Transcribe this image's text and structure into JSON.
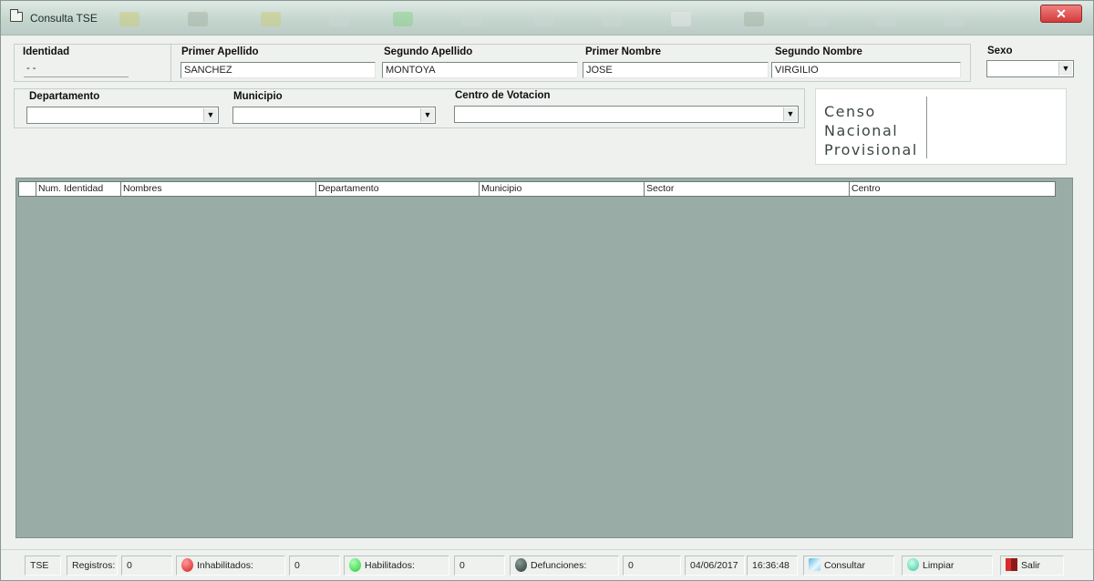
{
  "window": {
    "title": "Consulta TSE",
    "close_glyph": "✕"
  },
  "search": {
    "identidad": {
      "label": "Identidad",
      "value": "  -   -"
    },
    "primer_apellido": {
      "label": "Primer Apellido",
      "value": "SANCHEZ"
    },
    "segundo_apellido": {
      "label": "Segundo Apellido",
      "value": "MONTOYA"
    },
    "primer_nombre": {
      "label": "Primer Nombre",
      "value": "JOSE"
    },
    "segundo_nombre": {
      "label": "Segundo Nombre",
      "value": "VIRGILIO"
    },
    "sexo": {
      "label": "Sexo",
      "value": ""
    },
    "departamento": {
      "label": "Departamento",
      "value": ""
    },
    "municipio": {
      "label": "Municipio",
      "value": ""
    },
    "centro_votacion": {
      "label": "Centro de Votacion",
      "value": ""
    }
  },
  "logo": {
    "line1": "Censo",
    "line2": "Nacional",
    "line3": "Provisional"
  },
  "grid": {
    "columns": [
      "Num. Identidad",
      "Nombres",
      "Departamento",
      "Municipio",
      "Sector",
      "Centro"
    ],
    "rows": []
  },
  "statusbar": {
    "app": "TSE",
    "registros_label": "Registros:",
    "registros_value": "0",
    "inhabilitados_label": "Inhabilitados:",
    "inhabilitados_value": "0",
    "habilitados_label": "Habilitados:",
    "habilitados_value": "0",
    "defunciones_label": "Defunciones:",
    "defunciones_value": "0",
    "date": "04/06/2017",
    "time": "16:36:48",
    "consultar_label": "Consultar",
    "limpiar_label": "Limpiar",
    "salir_label": "Salir"
  },
  "colors": {
    "grid_background": "#9aaca6",
    "inhabilitados": "#d62020",
    "habilitados": "#2ccb3c",
    "defunciones": "#2b3b37"
  },
  "icons": {
    "title": "form-window-icon",
    "inhabilitados": "red-circle-icon",
    "habilitados": "green-circle-icon",
    "defunciones": "dark-circle-icon",
    "consultar": "search-doc-icon",
    "limpiar": "clear-icon",
    "salir": "exit-door-icon"
  }
}
